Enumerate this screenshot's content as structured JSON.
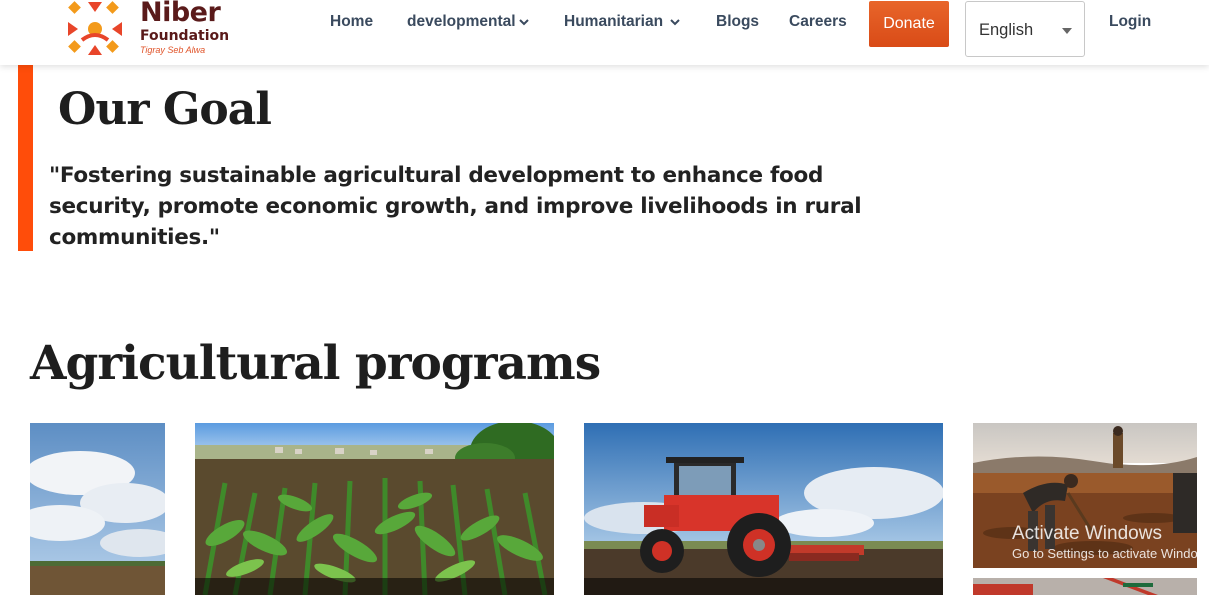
{
  "brand": {
    "name": "Niber",
    "sub": "Foundation",
    "tagline": "Tigray Seb Alwa",
    "colors": {
      "primary": "#5a1a1a",
      "accent": "#ff4d0a",
      "mark_orange": "#f39a1b",
      "mark_red": "#e8452a"
    }
  },
  "nav": {
    "home": "Home",
    "developmental": "developmental",
    "humanitarian": "Humanitarian",
    "blogs": "Blogs",
    "careers": "Careers",
    "donate": "Donate",
    "language": "English",
    "login": "Login"
  },
  "goal": {
    "title": "Our Goal",
    "quote": "\"Fostering sustainable agricultural development to enhance food security, promote economic growth, and improve livelihoods in rural communities.\""
  },
  "programs": {
    "title": "Agricultural programs"
  },
  "watermark": {
    "title": "Activate Windows",
    "sub": "Go to Settings to activate Windows."
  }
}
